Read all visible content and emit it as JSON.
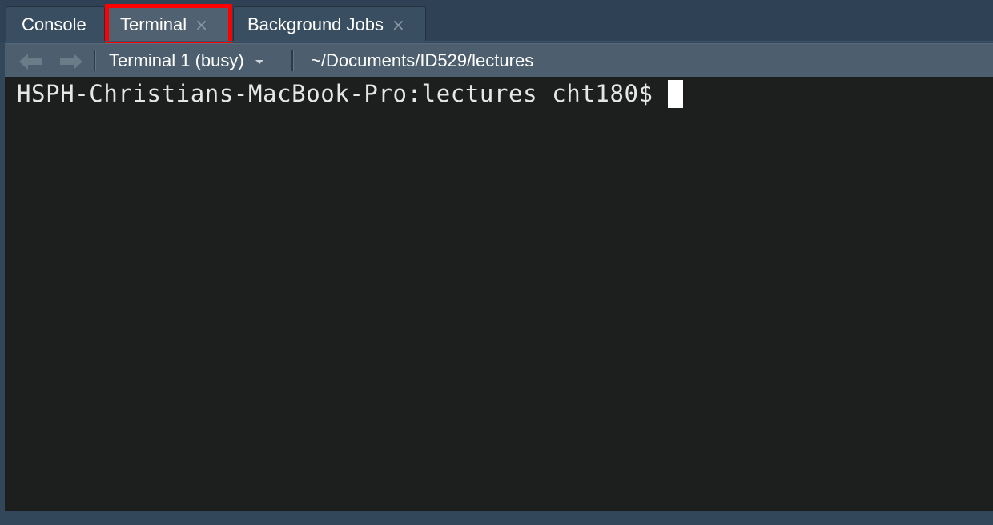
{
  "tabs": [
    {
      "label": "Console",
      "closable": false
    },
    {
      "label": "Terminal",
      "closable": true,
      "active": true,
      "highlighted": true
    },
    {
      "label": "Background Jobs",
      "closable": true
    }
  ],
  "close_glyph": "×",
  "toolbar": {
    "back_icon": "arrow-left-icon",
    "forward_icon": "arrow-right-icon",
    "terminal_selector": "Terminal 1 (busy)",
    "working_directory": "~/Documents/ID529/lectures"
  },
  "terminal": {
    "prompt": "HSPH-Christians-MacBook-Pro:lectures cht180$"
  },
  "colors": {
    "highlight": "#ff0000",
    "terminal_bg": "#1d1e1e",
    "chrome": "#33475a"
  }
}
